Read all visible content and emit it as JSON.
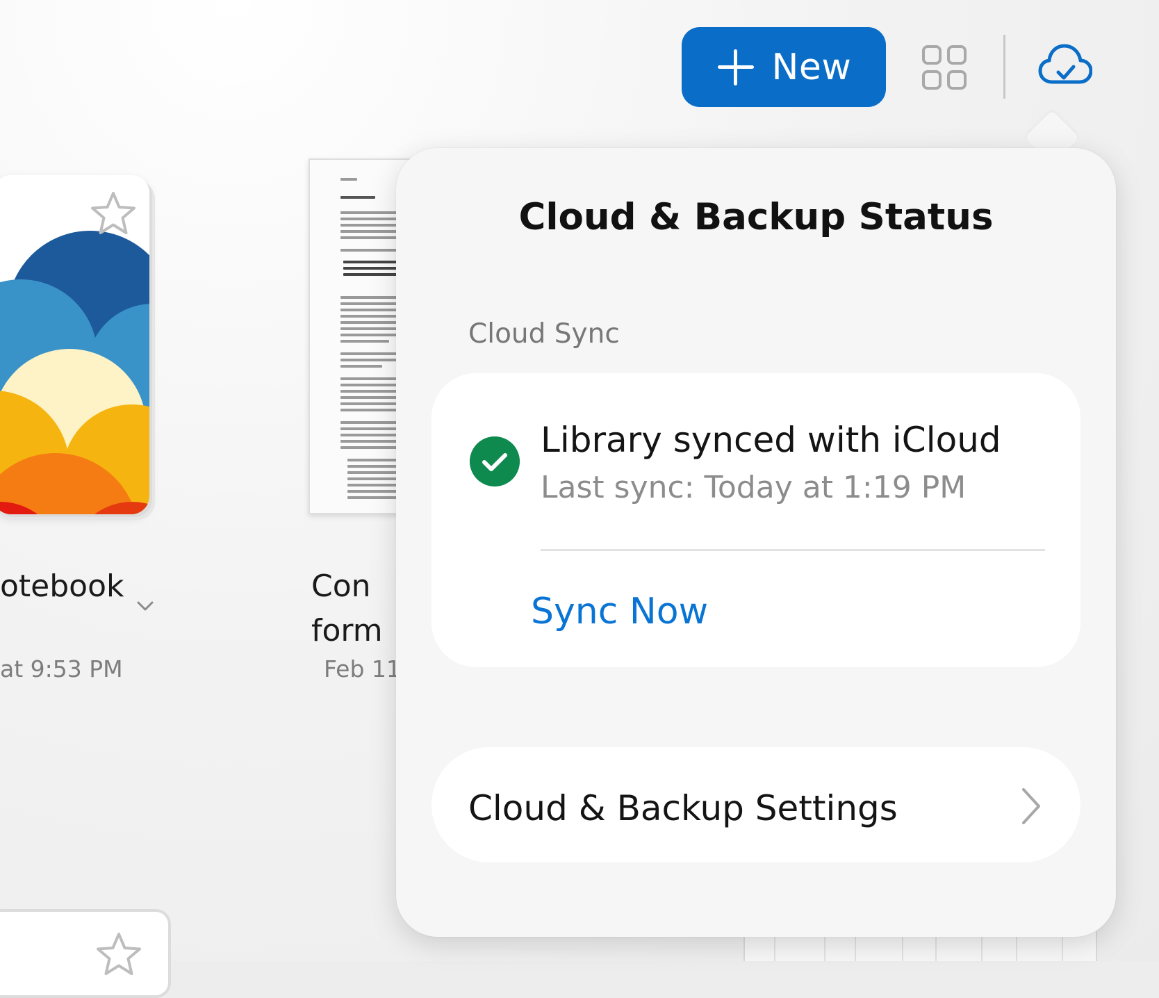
{
  "toolbar": {
    "new_label": "New",
    "icons": [
      "plus-icon",
      "grid-view-icon",
      "cloud-check-icon"
    ]
  },
  "library": {
    "items": [
      {
        "title": "otebook",
        "date": "at 9:53 PM",
        "cover": "notebook-cover",
        "starred": false
      },
      {
        "title_line1": "Con",
        "title_line2": "form",
        "date": "Feb 11,",
        "cover": "document-page",
        "starred": false
      }
    ]
  },
  "popover": {
    "title": "Cloud & Backup Status",
    "section_label": "Cloud Sync",
    "status_text": "Library synced with iCloud",
    "last_sync": "Last sync: Today at 1:19 PM",
    "sync_now_label": "Sync Now",
    "settings_label": "Cloud & Backup Settings"
  },
  "colors": {
    "accent": "#0a6dc7",
    "link": "#0a74d4",
    "success": "#0e8a4f"
  }
}
